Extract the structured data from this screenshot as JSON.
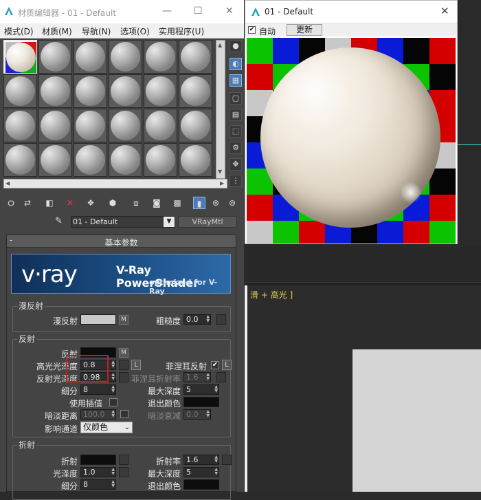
{
  "editor": {
    "title": "材质编辑器 - 01 - Default",
    "menu": [
      "模式(D)",
      "材质(M)",
      "导航(N)",
      "选项(O)",
      "实用程序(U)"
    ],
    "material_name": "01 - Default",
    "material_type": "VRayMtl"
  },
  "rollout": {
    "minus": "-",
    "title": "基本参数"
  },
  "banner": {
    "logo": "v·ray",
    "product": "V-Ray PowerShader",
    "tagline": "optimized for V-Ray"
  },
  "diffuse": {
    "group": "漫反射",
    "diffuse_label": "漫反射",
    "diffuse_color": "#c8c8c8",
    "map_button": "M",
    "roughness_label": "粗糙度",
    "roughness_value": "0.0"
  },
  "reflection": {
    "group": "反射",
    "reflect_label": "反射",
    "reflect_color": "#0d0d0d",
    "map_button": "M",
    "hilight_gloss_label": "高光光泽度",
    "hilight_gloss_value": "0.8",
    "lock_label": "L",
    "refl_gloss_label": "反射光泽度",
    "refl_gloss_value": "0.98",
    "subdivs_label": "细分",
    "subdivs_value": "8",
    "use_interp_label": "使用插值",
    "dim_distance_label": "暗淡距离",
    "dim_distance_value": "100.0",
    "affect_channels_label": "影响通道",
    "affect_channels_value": "仅颜色",
    "fresnel_label": "菲涅耳反射",
    "fresnel_checked": true,
    "fresnel_lock": "L",
    "fresnel_ior_label": "菲涅耳折射率",
    "fresnel_ior_value": "1.6",
    "max_depth_label": "最大深度",
    "max_depth_value": "5",
    "exit_color_label": "退出颜色",
    "exit_color": "#0d0d0d",
    "dim_falloff_label": "暗淡衰减",
    "dim_falloff_value": "0.0"
  },
  "refraction": {
    "group": "折射",
    "refract_label": "折射",
    "refract_color": "#0d0d0d",
    "gloss_label": "光泽度",
    "gloss_value": "1.0",
    "subdivs_label": "细分",
    "subdivs_value": "8",
    "ior_label": "折射率",
    "ior_value": "1.6",
    "max_depth_label": "最大深度",
    "max_depth_value": "5",
    "exit_color_label": "退出颜色",
    "exit_color": "#0d0d0d"
  },
  "preview": {
    "title": "01 - Default",
    "close": "✕",
    "auto_label": "自动",
    "auto_checked": true,
    "update_button": "更新",
    "checker_colors": {
      "r": "#d40000",
      "g": "#0cc300",
      "b": "#0a1bd8",
      "k": "#050505",
      "w": "#c8c8c8"
    }
  },
  "viewport": {
    "label": "滑 + 高光 ]"
  }
}
